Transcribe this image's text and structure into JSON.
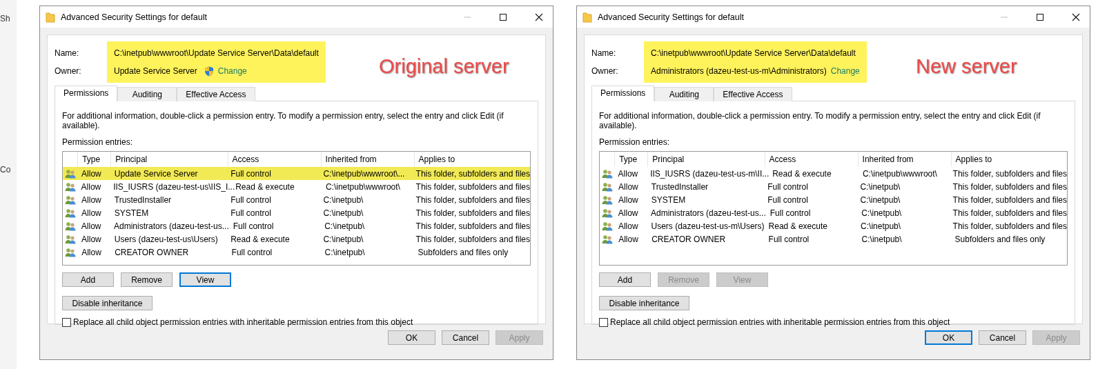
{
  "background_texts": [
    "Sh",
    "Co"
  ],
  "dialogs": [
    {
      "title": "Advanced Security Settings for default",
      "annotation": "Original server",
      "name_label": "Name:",
      "name_value": "C:\\inetpub\\wwwroot\\Update Service Server\\Data\\default",
      "owner_label": "Owner:",
      "owner_value": "Update Service Server",
      "owner_shield": true,
      "change_link": "Change",
      "header_highlighted": true,
      "tabs": [
        {
          "label": "Permissions",
          "selected": true
        },
        {
          "label": "Auditing",
          "selected": false
        },
        {
          "label": "Effective Access",
          "selected": false
        }
      ],
      "info": "For additional information, double-click a permission entry. To modify a permission entry, select the entry and click Edit (if available).",
      "entries_label": "Permission entries:",
      "columns": [
        "Type",
        "Principal",
        "Access",
        "Inherited from",
        "Applies to"
      ],
      "rows": [
        {
          "type": "Allow",
          "principal": "Update Service Server",
          "access": "Full control",
          "inherited_from": "C:\\inetpub\\wwwroot\\...",
          "applies_to": "This folder, subfolders and files",
          "highlighted": true
        },
        {
          "type": "Allow",
          "principal": "IIS_IUSRS (dazeu-test-us\\IIS_I...",
          "access": "Read & execute",
          "inherited_from": "C:\\inetpub\\wwwroot\\",
          "applies_to": "This folder, subfolders and files",
          "highlighted": false
        },
        {
          "type": "Allow",
          "principal": "TrustedInstaller",
          "access": "Full control",
          "inherited_from": "C:\\inetpub\\",
          "applies_to": "This folder, subfolders and files",
          "highlighted": false
        },
        {
          "type": "Allow",
          "principal": "SYSTEM",
          "access": "Full control",
          "inherited_from": "C:\\inetpub\\",
          "applies_to": "This folder, subfolders and files",
          "highlighted": false
        },
        {
          "type": "Allow",
          "principal": "Administrators (dazeu-test-us...",
          "access": "Full control",
          "inherited_from": "C:\\inetpub\\",
          "applies_to": "This folder, subfolders and files",
          "highlighted": false
        },
        {
          "type": "Allow",
          "principal": "Users (dazeu-test-us\\Users)",
          "access": "Read & execute",
          "inherited_from": "C:\\inetpub\\",
          "applies_to": "This folder, subfolders and files",
          "highlighted": false
        },
        {
          "type": "Allow",
          "principal": "CREATOR OWNER",
          "access": "Full control",
          "inherited_from": "C:\\inetpub\\",
          "applies_to": "Subfolders and files only",
          "highlighted": false
        }
      ],
      "entry_buttons": [
        {
          "label": "Add",
          "disabled": false,
          "focused": false
        },
        {
          "label": "Remove",
          "disabled": false,
          "focused": false
        },
        {
          "label": "View",
          "disabled": false,
          "focused": true
        }
      ],
      "inheritance_button": "Disable inheritance",
      "replace_checkbox": {
        "label": "Replace all child object permission entries with inheritable permission entries from this object",
        "checked": false
      },
      "footer_buttons": [
        {
          "label": "OK",
          "disabled": false,
          "focused": false
        },
        {
          "label": "Cancel",
          "disabled": false,
          "focused": false
        },
        {
          "label": "Apply",
          "disabled": true,
          "focused": false
        }
      ]
    },
    {
      "title": "Advanced Security Settings for default",
      "annotation": "New server",
      "name_label": "Name:",
      "name_value": "C:\\inetpub\\wwwroot\\Update Service Server\\Data\\default",
      "owner_label": "Owner:",
      "owner_value": "Administrators (dazeu-test-us-m\\Administrators)",
      "owner_shield": false,
      "change_link": "Change",
      "header_highlighted": true,
      "tabs": [
        {
          "label": "Permissions",
          "selected": true
        },
        {
          "label": "Auditing",
          "selected": false
        },
        {
          "label": "Effective Access",
          "selected": false
        }
      ],
      "info": "For additional information, double-click a permission entry. To modify a permission entry, select the entry and click Edit (if available).",
      "entries_label": "Permission entries:",
      "columns": [
        "Type",
        "Principal",
        "Access",
        "Inherited from",
        "Applies to"
      ],
      "rows": [
        {
          "type": "Allow",
          "principal": "IIS_IUSRS (dazeu-test-us-m\\II...",
          "access": "Read & execute",
          "inherited_from": "C:\\inetpub\\wwwroot\\",
          "applies_to": "This folder, subfolders and files",
          "highlighted": false
        },
        {
          "type": "Allow",
          "principal": "TrustedInstaller",
          "access": "Full control",
          "inherited_from": "C:\\inetpub\\",
          "applies_to": "This folder, subfolders and files",
          "highlighted": false
        },
        {
          "type": "Allow",
          "principal": "SYSTEM",
          "access": "Full control",
          "inherited_from": "C:\\inetpub\\",
          "applies_to": "This folder, subfolders and files",
          "highlighted": false
        },
        {
          "type": "Allow",
          "principal": "Administrators (dazeu-test-us...",
          "access": "Full control",
          "inherited_from": "C:\\inetpub\\",
          "applies_to": "This folder, subfolders and files",
          "highlighted": false
        },
        {
          "type": "Allow",
          "principal": "Users (dazeu-test-us-m\\Users)",
          "access": "Read & execute",
          "inherited_from": "C:\\inetpub\\",
          "applies_to": "This folder, subfolders and files",
          "highlighted": false
        },
        {
          "type": "Allow",
          "principal": "CREATOR OWNER",
          "access": "Full control",
          "inherited_from": "C:\\inetpub\\",
          "applies_to": "Subfolders and files only",
          "highlighted": false
        }
      ],
      "entry_buttons": [
        {
          "label": "Add",
          "disabled": false,
          "focused": false
        },
        {
          "label": "Remove",
          "disabled": true,
          "focused": false
        },
        {
          "label": "View",
          "disabled": true,
          "focused": false
        }
      ],
      "inheritance_button": "Disable inheritance",
      "replace_checkbox": {
        "label": "Replace all child object permission entries with inheritable permission entries from this object",
        "checked": false
      },
      "footer_buttons": [
        {
          "label": "OK",
          "disabled": false,
          "focused": true
        },
        {
          "label": "Cancel",
          "disabled": false,
          "focused": false
        },
        {
          "label": "Apply",
          "disabled": true,
          "focused": false
        }
      ]
    }
  ]
}
